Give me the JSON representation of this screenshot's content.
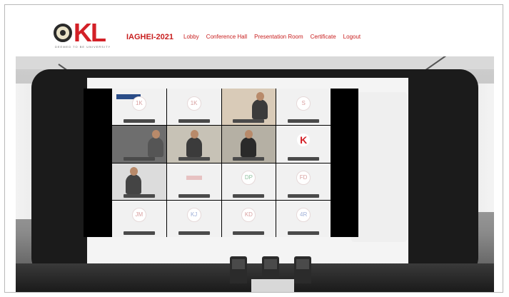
{
  "header": {
    "logo_text": "KL",
    "logo_tagline": "DEEMED TO BE UNIVERSITY",
    "brand": "IAGHEI-2021",
    "nav": [
      {
        "label": "Lobby"
      },
      {
        "label": "Conference Hall"
      },
      {
        "label": "Presentation Room"
      },
      {
        "label": "Certificate"
      },
      {
        "label": "Logout"
      }
    ]
  },
  "video_grid": {
    "tiles": [
      {
        "kind": "avatar",
        "text": "1K"
      },
      {
        "kind": "avatar",
        "text": "1K"
      },
      {
        "kind": "camera",
        "text": ""
      },
      {
        "kind": "avatar",
        "text": "S"
      },
      {
        "kind": "camera",
        "text": ""
      },
      {
        "kind": "camera",
        "text": ""
      },
      {
        "kind": "camera",
        "text": ""
      },
      {
        "kind": "logo",
        "text": "K"
      },
      {
        "kind": "camera",
        "text": ""
      },
      {
        "kind": "bar",
        "text": ""
      },
      {
        "kind": "avatar",
        "text": "DP"
      },
      {
        "kind": "avatar",
        "text": "FD"
      },
      {
        "kind": "avatar",
        "text": "JM"
      },
      {
        "kind": "avatar",
        "text": "KJ"
      },
      {
        "kind": "avatar",
        "text": "KD"
      },
      {
        "kind": "avatar",
        "text": "4R"
      }
    ]
  }
}
